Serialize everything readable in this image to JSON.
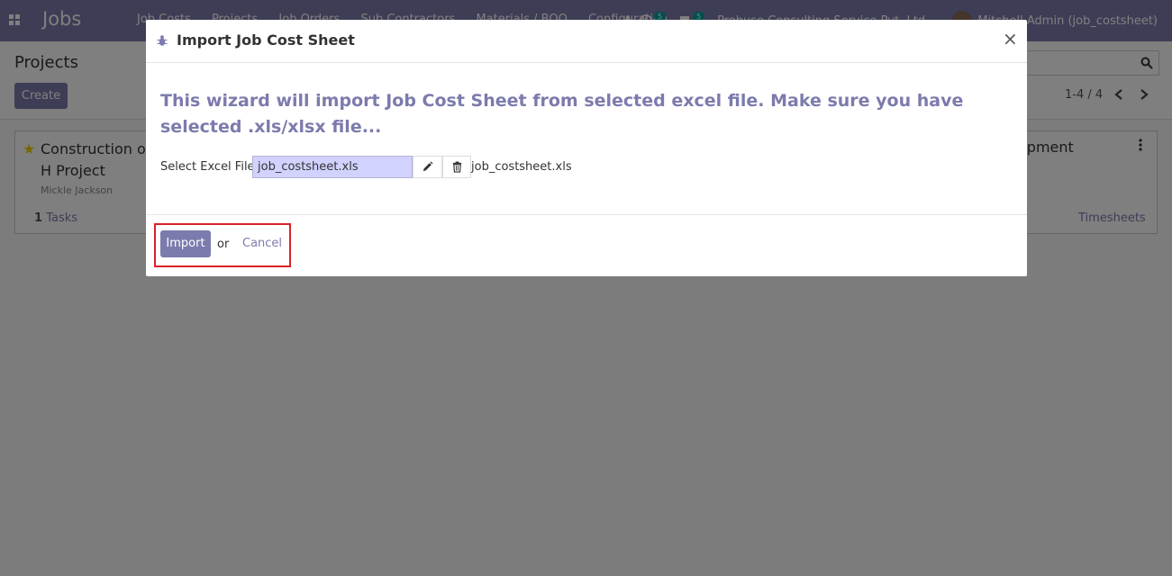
{
  "navbar": {
    "brand": "Jobs",
    "menu": [
      "Job Costs",
      "Projects",
      "Job Orders",
      "Sub Contractors",
      "Materials / BOQ",
      "Configuration"
    ],
    "activity_badge": "5",
    "message_badge": "5",
    "company": "Probuse Consulting Service Pvt. Ltd.",
    "user": "Mitchell Admin (job_costsheet)"
  },
  "control_panel": {
    "breadcrumb": "Projects",
    "create_label": "Create",
    "pager": "1-4 / 4"
  },
  "kanban": {
    "card": {
      "title": "Construction of H Project",
      "manager": "Mickle Jackson",
      "tasks_count": "1",
      "tasks_label": "Tasks",
      "right_title": "opment",
      "timesheets_label": "Timesheets"
    }
  },
  "modal": {
    "title": "Import Job Cost Sheet",
    "close": "×",
    "wizard_text": "This wizard will import Job Cost Sheet from selected excel file. Make sure you have selected .xls/xlsx file...",
    "field_label": "Select Excel File",
    "file_value": "job_costsheet.xls",
    "file_name": "job_costsheet.xls",
    "import_label": "Import",
    "or_text": "or",
    "cancel_label": "Cancel"
  },
  "colors": {
    "primary": "#7c7bad",
    "highlight": "#d9222a",
    "file_input_bg": "#d2d2ff"
  }
}
